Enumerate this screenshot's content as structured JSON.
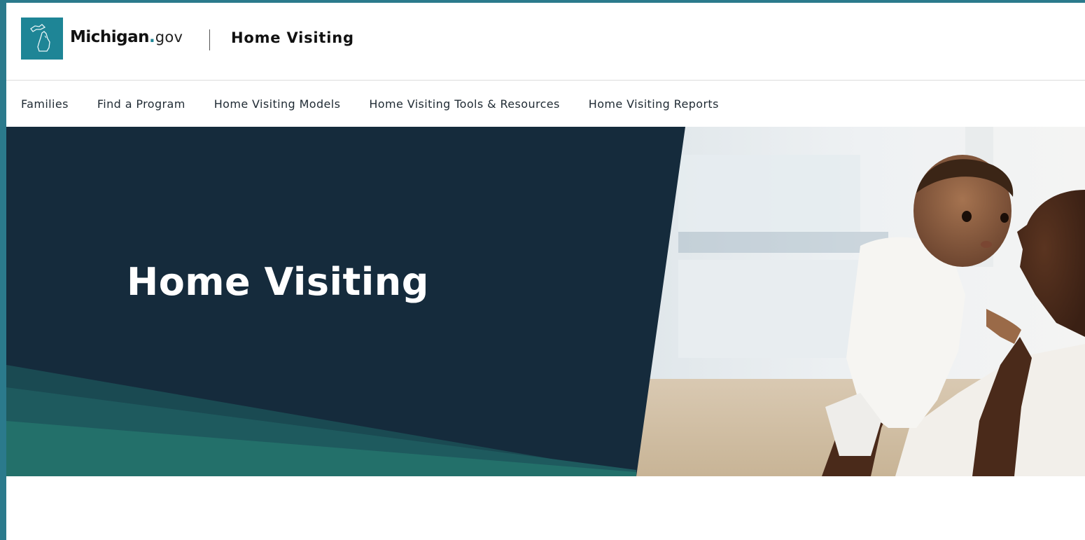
{
  "header": {
    "brand_name": "Michigan",
    "brand_dot": ".",
    "brand_suffix": "gov",
    "site_title": "Home Visiting",
    "logo_icon": "michigan-state-outline-icon"
  },
  "nav": {
    "items": [
      {
        "label": "Families"
      },
      {
        "label": "Find a Program"
      },
      {
        "label": "Home Visiting Models"
      },
      {
        "label": "Home Visiting Tools & Resources"
      },
      {
        "label": "Home Visiting Reports"
      }
    ]
  },
  "hero": {
    "title": "Home Visiting",
    "image_subject": "mother kissing infant photo"
  },
  "colors": {
    "frame": "#2b7a8c",
    "brand_teal": "#1e8596",
    "hero_navy": "#152b3c",
    "hero_accent_dark": "#1a4a52",
    "hero_accent_teal": "#23706a"
  }
}
